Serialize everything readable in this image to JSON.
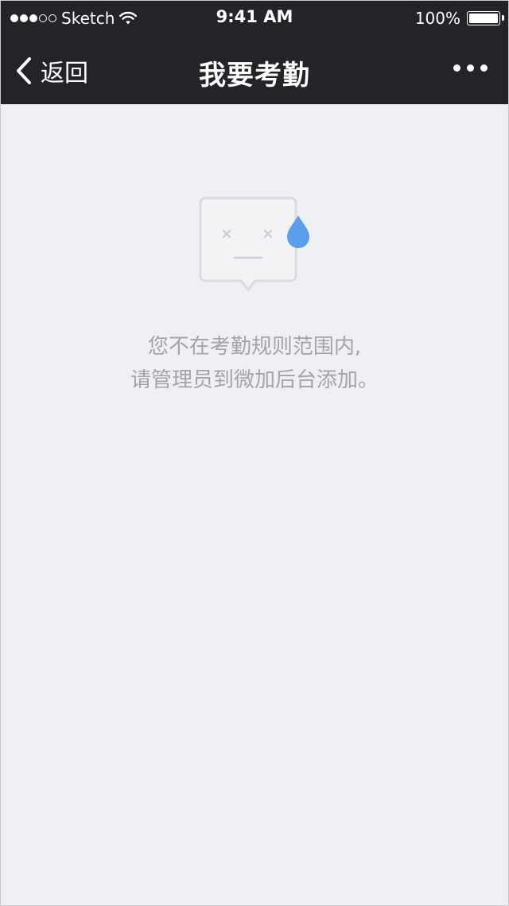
{
  "status_bar": {
    "carrier": "Sketch",
    "time": "9:41 AM",
    "battery": "100%",
    "signal_icon": "signal-dots-icon",
    "wifi_icon": "wifi-icon",
    "battery_icon": "battery-icon"
  },
  "nav": {
    "back_label": "返回",
    "back_icon": "chevron-left-icon",
    "title": "我要考勤",
    "more_icon": "more-dots-icon"
  },
  "empty_state": {
    "illustration": "sad-face-sweat-icon",
    "message_line1": "您不在考勤规则范围内,",
    "message_line2": "请管理员到微加后台添加。",
    "accent_color": "#5b9ee9",
    "text_color": "#a3a3a8"
  },
  "colors": {
    "bar_background": "#222427",
    "page_background": "#efeff4"
  }
}
